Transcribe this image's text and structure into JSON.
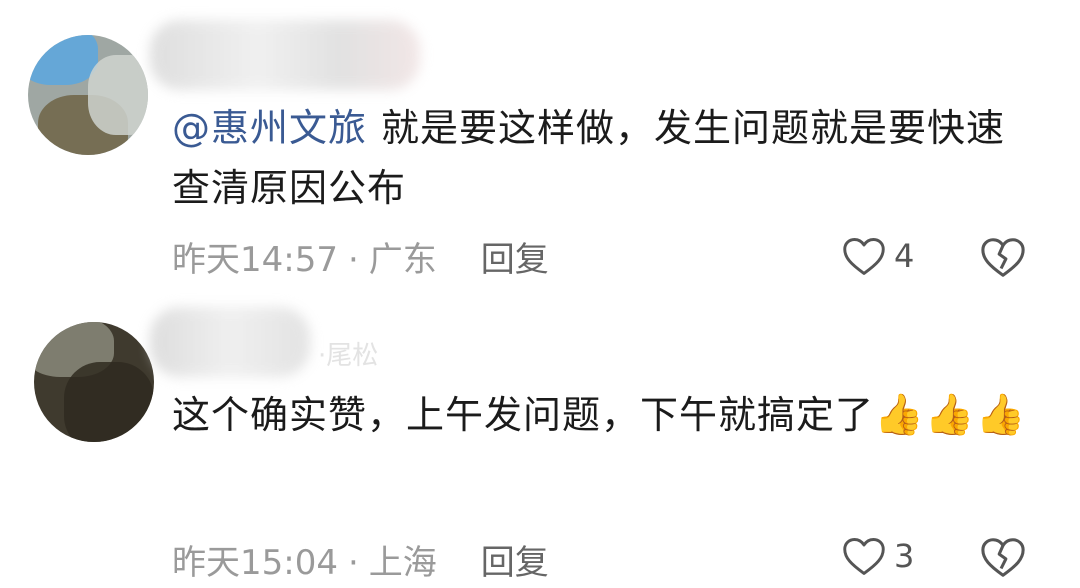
{
  "comments": [
    {
      "mention": "@惠州文旅",
      "text": "就是要这样做，发生问题就是要快速查清原因公布",
      "time": "昨天14:57",
      "location": "广东",
      "reply_label": "回复",
      "likes": "4",
      "like_icon": "heart-outline-icon",
      "dislike_icon": "broken-heart-icon"
    },
    {
      "name_fragment": "·尾松",
      "text": "这个确实赞，上午发问题，下午就搞定了",
      "emojis": "👍👍👍",
      "time": "昨天15:04",
      "location": "上海",
      "reply_label": "回复",
      "likes": "3",
      "like_icon": "heart-outline-icon",
      "dislike_icon": "broken-heart-icon"
    }
  ],
  "separator": "·"
}
